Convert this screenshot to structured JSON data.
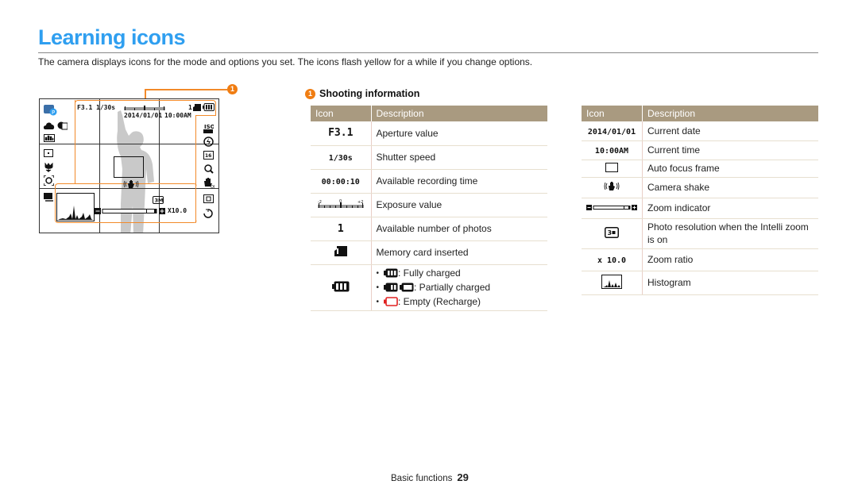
{
  "page": {
    "title": "Learning icons",
    "intro": "The camera displays icons for the mode and options you set. The icons flash yellow for a while if you change options."
  },
  "illustration": {
    "callout_number": "1",
    "osd": {
      "aperture": "F3.1",
      "shutter": "1/30s",
      "photos_remaining": "1",
      "date": "2014/01/01",
      "time": "10:00AM",
      "iso_label": "ISO",
      "zoom_ratio": "X10.0",
      "resolution": "3M"
    }
  },
  "section": {
    "number": "1",
    "title": "Shooting information"
  },
  "table_left": {
    "headers": [
      "Icon",
      "Description"
    ],
    "rows": [
      {
        "icon": "F3.1",
        "icon_name": "aperture-icon",
        "description": "Aperture value"
      },
      {
        "icon": "1/30s",
        "icon_name": "shutter-speed-icon",
        "description": "Shutter speed"
      },
      {
        "icon": "00:00:10",
        "icon_name": "recording-time-icon",
        "description": "Available recording time"
      },
      {
        "icon": "exposure-scale",
        "icon_name": "exposure-value-icon",
        "description": "Exposure value"
      },
      {
        "icon": "1",
        "icon_name": "photo-count-icon",
        "description": "Available number of photos"
      },
      {
        "icon": "memory-card",
        "icon_name": "memory-card-icon",
        "description": "Memory card inserted"
      },
      {
        "icon": "battery",
        "icon_name": "battery-icon",
        "description_list": [
          {
            "text": ": Fully charged",
            "icon_name": "battery-full-icon"
          },
          {
            "text": ": Partially charged",
            "icon_name": "battery-partial-icon"
          },
          {
            "text": ": Empty (Recharge)",
            "icon_name": "battery-empty-icon",
            "color": "#e02020"
          }
        ]
      }
    ]
  },
  "table_right": {
    "headers": [
      "Icon",
      "Description"
    ],
    "rows": [
      {
        "icon": "2014/01/01",
        "icon_name": "current-date-icon",
        "description": "Current date"
      },
      {
        "icon": "10:00AM",
        "icon_name": "current-time-icon",
        "description": "Current time"
      },
      {
        "icon": "af-frame",
        "icon_name": "auto-focus-frame-icon",
        "description": "Auto focus frame"
      },
      {
        "icon": "camera-shake",
        "icon_name": "camera-shake-icon",
        "description": "Camera shake"
      },
      {
        "icon": "zoom-bar",
        "icon_name": "zoom-indicator-icon",
        "description": "Zoom indicator"
      },
      {
        "icon": "3M",
        "icon_name": "intelli-zoom-resolution-icon",
        "description": "Photo resolution when the Intelli zoom is on"
      },
      {
        "icon": "x 10.0",
        "icon_name": "zoom-ratio-icon",
        "description": "Zoom ratio"
      },
      {
        "icon": "histogram",
        "icon_name": "histogram-icon",
        "description": "Histogram"
      }
    ]
  },
  "footer": {
    "section": "Basic functions",
    "page_number": "29"
  },
  "colors": {
    "title": "#2f9ff0",
    "table_header": "#a99a80",
    "callout": "#f07d12",
    "battery_empty": "#e02020"
  }
}
